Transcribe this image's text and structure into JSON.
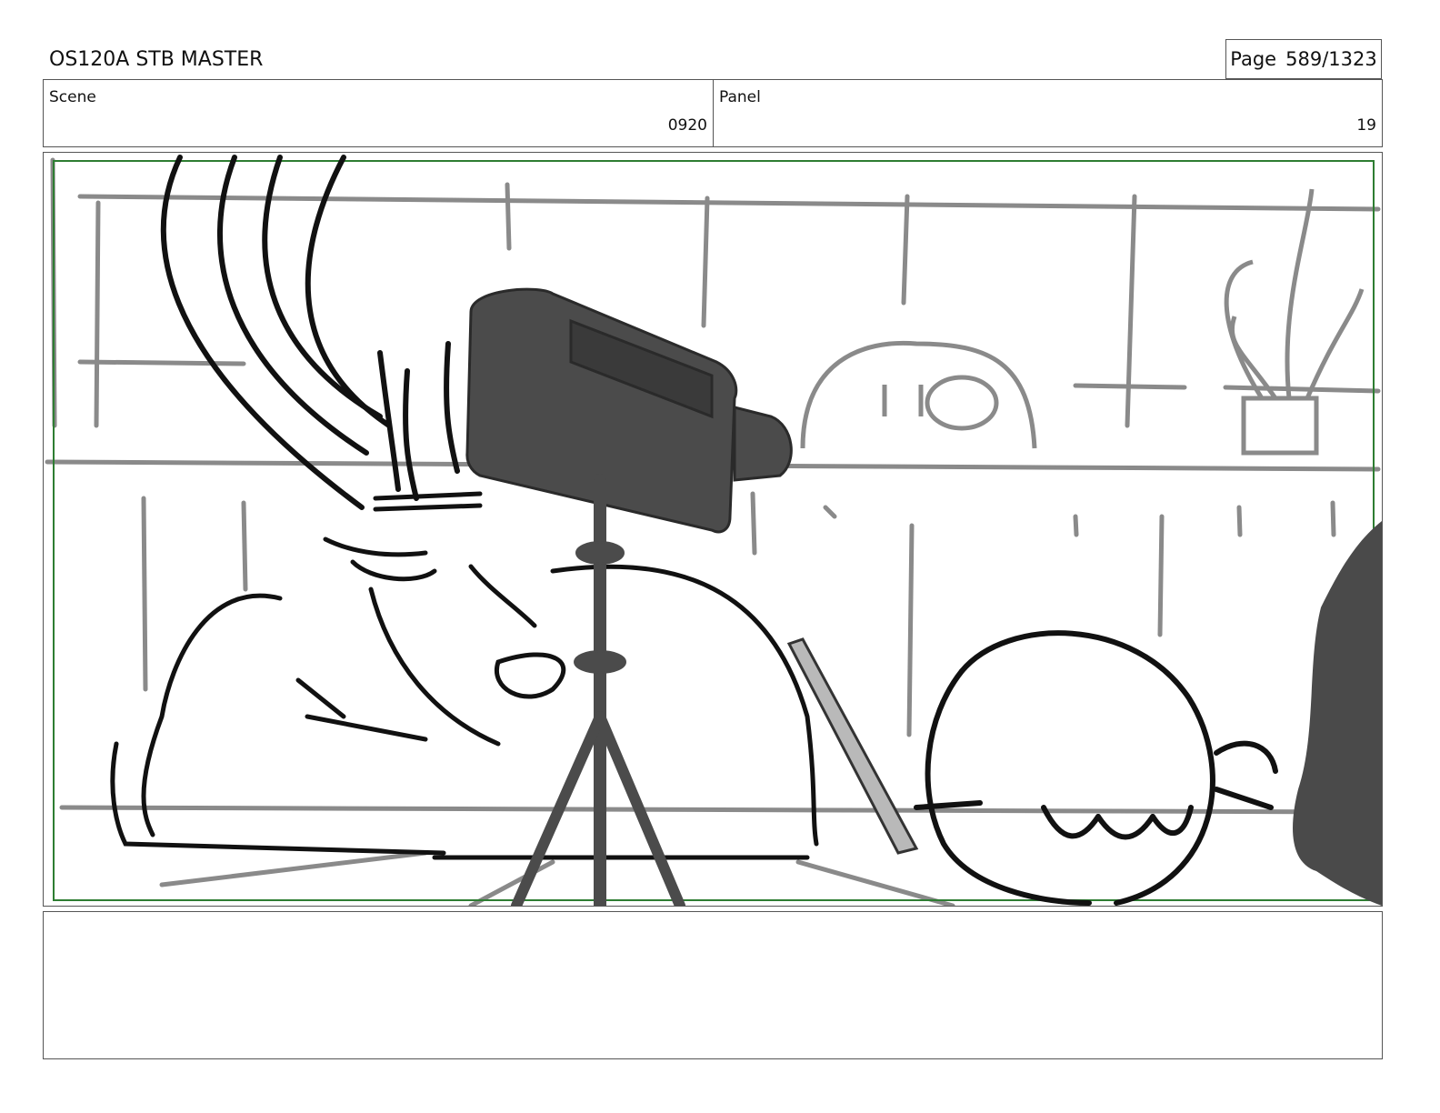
{
  "header": {
    "document_title": "OS120A STB MASTER",
    "page_label": "Page",
    "page_number": "589/1323"
  },
  "scene": {
    "label": "Scene",
    "value": "0920"
  },
  "panel": {
    "label": "Panel",
    "value": "19"
  },
  "frame": {
    "safe_area_color": "#2e7d32",
    "content": "storyboard-sketch"
  },
  "notes": {
    "text": ""
  }
}
